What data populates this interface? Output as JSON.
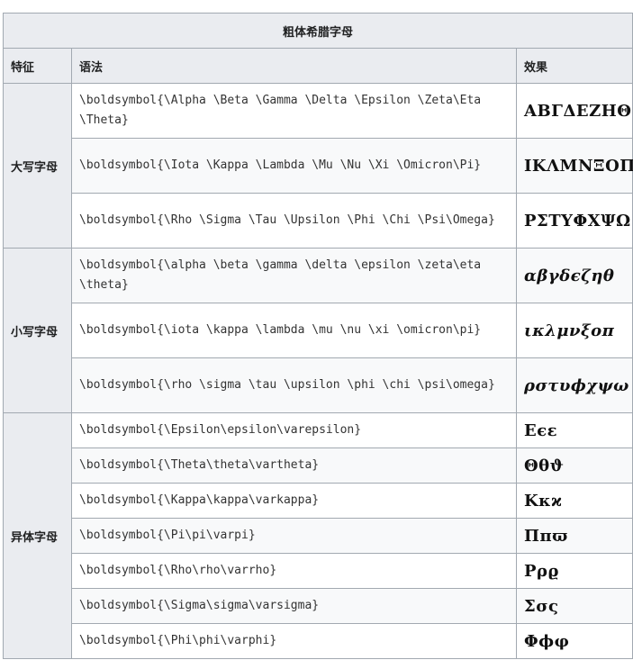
{
  "table": {
    "caption": "粗体希腊字母",
    "headers": {
      "feature": "特征",
      "syntax": "语法",
      "result": "效果"
    },
    "groups": [
      {
        "feature": "大写字母",
        "rows": [
          {
            "syntax": "\\boldsymbol{\\Alpha \\Beta \\Gamma \\Delta \\Epsilon \\Zeta\\Eta \\Theta}",
            "result": "ΑΒΓΔΕΖΗΘ"
          },
          {
            "syntax": "\\boldsymbol{\\Iota \\Kappa \\Lambda \\Mu \\Nu \\Xi \\Omicron\\Pi}",
            "result": "ΙΚΛΜΝΞΟΠ"
          },
          {
            "syntax": "\\boldsymbol{\\Rho \\Sigma \\Tau \\Upsilon \\Phi \\Chi \\Psi\\Omega}",
            "result": "ΡΣΤΥΦΧΨΩ"
          }
        ]
      },
      {
        "feature": "小写字母",
        "rows": [
          {
            "syntax": "\\boldsymbol{\\alpha \\beta \\gamma \\delta \\epsilon \\zeta\\eta \\theta}",
            "result": "αβγδϵζηθ"
          },
          {
            "syntax": "\\boldsymbol{\\iota \\kappa \\lambda \\mu \\nu \\xi \\omicron\\pi}",
            "result": "ικλμνξοπ"
          },
          {
            "syntax": "\\boldsymbol{\\rho \\sigma \\tau \\upsilon \\phi \\chi \\psi\\omega}",
            "result": "ρστυϕχψω"
          }
        ]
      },
      {
        "feature": "异体字母",
        "rows": [
          {
            "syntax": "\\boldsymbol{\\Epsilon\\epsilon\\varepsilon}",
            "result": "Εϵε"
          },
          {
            "syntax": "\\boldsymbol{\\Theta\\theta\\vartheta}",
            "result": "Θθϑ"
          },
          {
            "syntax": "\\boldsymbol{\\Kappa\\kappa\\varkappa}",
            "result": "Κκϰ"
          },
          {
            "syntax": "\\boldsymbol{\\Pi\\pi\\varpi}",
            "result": "Ππϖ"
          },
          {
            "syntax": "\\boldsymbol{\\Rho\\rho\\varrho}",
            "result": "Ρρϱ"
          },
          {
            "syntax": "\\boldsymbol{\\Sigma\\sigma\\varsigma}",
            "result": "Σσς"
          },
          {
            "syntax": "\\boldsymbol{\\Phi\\phi\\varphi}",
            "result": "Φϕφ"
          }
        ]
      }
    ]
  }
}
